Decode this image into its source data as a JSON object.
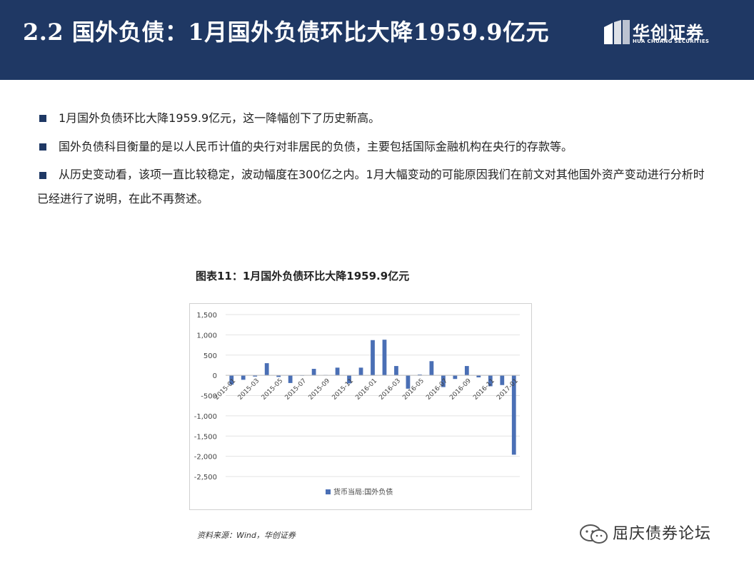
{
  "header": {
    "title": "2.2 国外负债：1月国外负债环比大降1959.9亿元",
    "logo_cn": "华创证券",
    "logo_en": "HUA CHUANG SECURITIES",
    "background_color": "#1f3864"
  },
  "bullets": [
    "1月国外负债环比大降1959.9亿元，这一降幅创下了历史新高。",
    "国外负债科目衡量的是以人民币计值的央行对非居民的负债，主要包括国际金融机构在央行的存款等。",
    "从历史变动看，该项一直比较稳定，波动幅度在300亿之内。1月大幅变动的可能原因我们在前文对其他国外资产变动进行分析时已经进行了说明，在此不再赘述。"
  ],
  "chart_title": "图表11：1月国外负债环比大降1959.9亿元",
  "source": "资料来源：Wind，华创证券",
  "watermark": "屈庆债券论坛",
  "chart_data": {
    "type": "bar",
    "categories": [
      "2015-01",
      "2015-02",
      "2015-03",
      "2015-04",
      "2015-05",
      "2015-06",
      "2015-07",
      "2015-08",
      "2015-09",
      "2015-10",
      "2015-11",
      "2015-12",
      "2016-01",
      "2016-02",
      "2016-03",
      "2016-04",
      "2016-05",
      "2016-06",
      "2016-07",
      "2016-08",
      "2016-09",
      "2016-10",
      "2016-11",
      "2016-12",
      "2017-01"
    ],
    "x_tick_labels": [
      "2015-01",
      "2015-03",
      "2015-05",
      "2015-07",
      "2015-09",
      "2015-11",
      "2016-01",
      "2016-03",
      "2016-05",
      "2016-07",
      "2016-09",
      "2016-11",
      "2017-01"
    ],
    "y_tick_labels": [
      "1,500",
      "1,000",
      "500",
      "0",
      "-500",
      "-1,000",
      "-1,500",
      "-2,000",
      "-2,500"
    ],
    "series": [
      {
        "name": "货币当局:国外负债",
        "color": "#4a6fb5",
        "values": [
          -230,
          -110,
          -30,
          300,
          -40,
          -190,
          -10,
          160,
          10,
          190,
          -200,
          190,
          870,
          880,
          230,
          -330,
          20,
          350,
          -290,
          -90,
          230,
          -50,
          -270,
          -240,
          -1959.9
        ]
      }
    ],
    "ylim": [
      -2500,
      1500
    ],
    "yticks": [
      1500,
      1000,
      500,
      0,
      -500,
      -1000,
      -1500,
      -2000,
      -2500
    ],
    "grid": true,
    "legend_position": "bottom"
  }
}
